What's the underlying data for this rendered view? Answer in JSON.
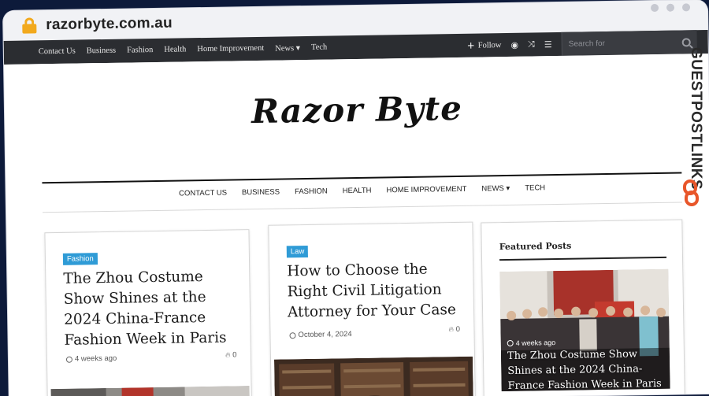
{
  "browser": {
    "url": "razorbyte.com.au"
  },
  "topnav": {
    "links": [
      "Contact Us",
      "Business",
      "Fashion",
      "Health",
      "Home Improvement",
      "News ▾",
      "Tech"
    ],
    "follow_label": "Follow",
    "search_placeholder": "Search for"
  },
  "site": {
    "logo": "Razor Byte"
  },
  "mainnav": {
    "items": [
      "CONTACT US",
      "BUSINESS",
      "FASHION",
      "HEALTH",
      "HOME IMPROVEMENT",
      "NEWS ▾",
      "TECH"
    ]
  },
  "posts": [
    {
      "tag": "Fashion",
      "title": "The Zhou Costume Show Shines at the 2024 China-France Fashion Week in Paris",
      "date": "4 weeks ago",
      "views": "0"
    },
    {
      "tag": "Law",
      "title": "How to Choose the Right Civil Litigation Attorney for Your Case",
      "date": "October 4, 2024",
      "views": "0"
    }
  ],
  "featured": {
    "heading": "Featured Posts",
    "date": "4 weeks ago",
    "headline": "The Zhou Costume Show Shines at the 2024 China-France Fashion Week in Paris"
  },
  "watermark": {
    "text": "GUESTPOSTLINKS"
  },
  "colors": {
    "accent_tag": "#2f9bd6",
    "topnav_bg": "#2b2d31",
    "lock": "#f2a91d",
    "watermark_logo": "#e8562a"
  }
}
